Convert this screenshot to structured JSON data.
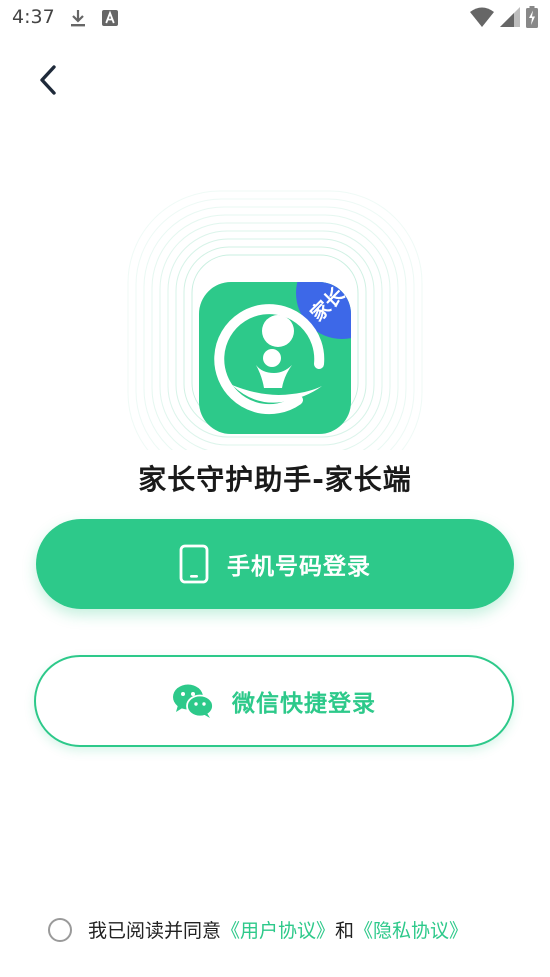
{
  "status_bar": {
    "time": "4:37",
    "icons": [
      "download-icon",
      "text-a-icon",
      "wifi-icon",
      "signal-icon",
      "battery-charging-icon"
    ]
  },
  "navigation": {
    "back_icon": "chevron-left-icon"
  },
  "logo": {
    "badge_text": "家长",
    "colors": {
      "primary": "#2dc98a",
      "badge": "#3d68e8"
    }
  },
  "app": {
    "title": "家长守护助手-家长端"
  },
  "buttons": {
    "phone_login": {
      "label": "手机号码登录",
      "icon": "phone-icon"
    },
    "wechat_login": {
      "label": "微信快捷登录",
      "icon": "wechat-icon"
    }
  },
  "agreement": {
    "prefix": "我已阅读并同意",
    "user_agreement": "《用户协议》",
    "conjunction": "和",
    "privacy_agreement": "《隐私协议》"
  },
  "theme": {
    "accent": "#2dc98a",
    "text": "#1a1a1a"
  }
}
